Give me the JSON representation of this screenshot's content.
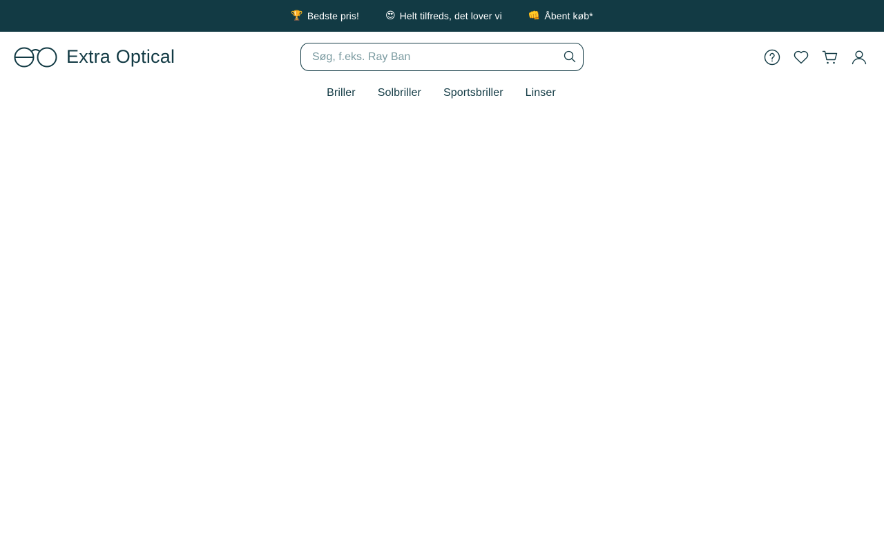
{
  "topbar": {
    "items": [
      {
        "emoji": "🏆",
        "text": "Bedste pris!"
      },
      {
        "emoji": "😍",
        "text": "Helt tilfreds, det lover vi"
      },
      {
        "emoji": "👊",
        "text": "Åbent køb*"
      }
    ]
  },
  "header": {
    "logo_text": "Extra Optical",
    "search": {
      "value": "",
      "placeholder": "Søg, f.eks. Ray Ban"
    },
    "icons": [
      "help-icon",
      "heart-icon",
      "cart-icon",
      "user-icon"
    ]
  },
  "nav": {
    "items": [
      "Briller",
      "Solbriller",
      "Sportsbriller",
      "Linser"
    ]
  },
  "colors": {
    "brand": "#123a44",
    "placeholder": "#7a9aa0",
    "background": "#ffffff"
  }
}
